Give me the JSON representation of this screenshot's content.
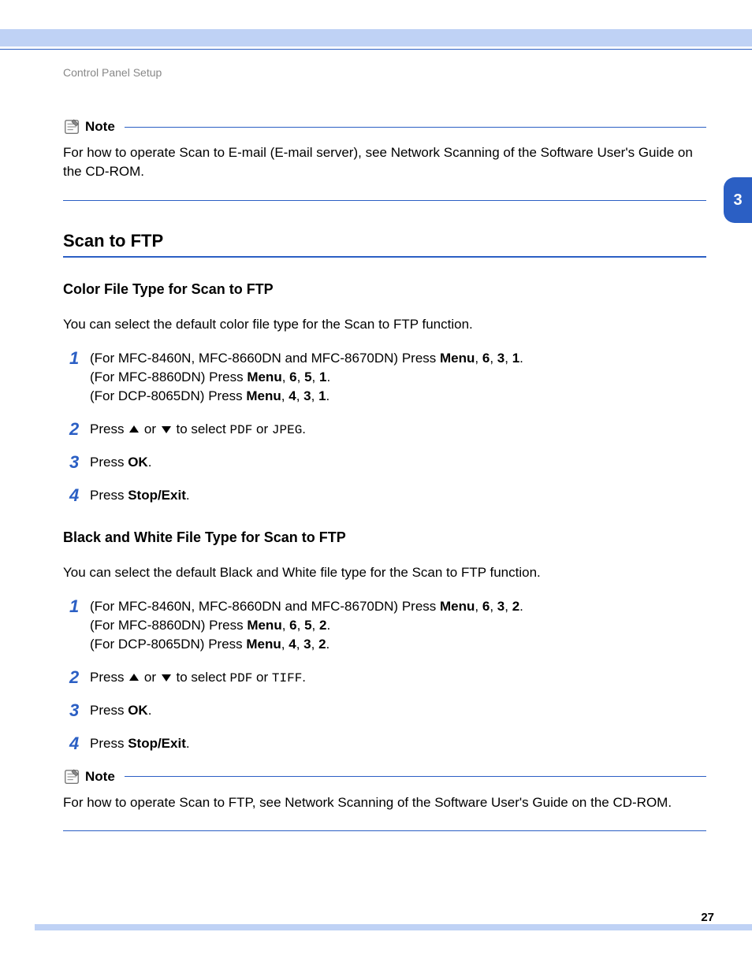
{
  "runningHeader": "Control Panel Setup",
  "chapterNumber": "3",
  "pageNumber": "27",
  "note1": {
    "label": "Note",
    "text": "For how to operate Scan to E-mail (E-mail server), see Network Scanning of the Software User's Guide on the CD-ROM."
  },
  "section": {
    "title": "Scan to FTP",
    "sub1": {
      "title": "Color File Type for Scan to FTP",
      "intro": "You can select the default color file type for the Scan to FTP function.",
      "step1": {
        "line1_a": "(For MFC-8460N, MFC-8660DN and MFC-8670DN) Press ",
        "line1_menu": "Menu",
        "line1_b": ", ",
        "line1_k1": "6",
        "line1_c": ", ",
        "line1_k2": "3",
        "line1_d": ", ",
        "line1_k3": "1",
        "line1_e": ".",
        "line2_a": "(For MFC-8860DN) Press ",
        "line2_menu": "Menu",
        "line2_b": ", ",
        "line2_k1": "6",
        "line2_c": ", ",
        "line2_k2": "5",
        "line2_d": ", ",
        "line2_k3": "1",
        "line2_e": ".",
        "line3_a": "(For DCP-8065DN) Press ",
        "line3_menu": "Menu",
        "line3_b": ", ",
        "line3_k1": "4",
        "line3_c": ", ",
        "line3_k2": "3",
        "line3_d": ", ",
        "line3_k3": "1",
        "line3_e": "."
      },
      "step2": {
        "a": "Press ",
        "b": " or ",
        "c": " to select ",
        "opt1": "PDF",
        "d": " or ",
        "opt2": "JPEG",
        "e": "."
      },
      "step3": {
        "a": "Press ",
        "ok": "OK",
        "b": "."
      },
      "step4": {
        "a": "Press ",
        "stop": "Stop/Exit",
        "b": "."
      }
    },
    "sub2": {
      "title": "Black and White File Type for Scan to FTP",
      "intro": "You can select the default Black and White file type for the Scan to FTP function.",
      "step1": {
        "line1_a": "(For MFC-8460N, MFC-8660DN and MFC-8670DN) Press ",
        "line1_menu": "Menu",
        "line1_b": ", ",
        "line1_k1": "6",
        "line1_c": ", ",
        "line1_k2": "3",
        "line1_d": ", ",
        "line1_k3": "2",
        "line1_e": ".",
        "line2_a": "(For MFC-8860DN) Press ",
        "line2_menu": "Menu",
        "line2_b": ", ",
        "line2_k1": "6",
        "line2_c": ", ",
        "line2_k2": "5",
        "line2_d": ", ",
        "line2_k3": "2",
        "line2_e": ".",
        "line3_a": "(For DCP-8065DN) Press ",
        "line3_menu": "Menu",
        "line3_b": ", ",
        "line3_k1": "4",
        "line3_c": ", ",
        "line3_k2": "3",
        "line3_d": ", ",
        "line3_k3": "2",
        "line3_e": "."
      },
      "step2": {
        "a": "Press ",
        "b": " or ",
        "c": " to select ",
        "opt1": "PDF",
        "d": " or ",
        "opt2": "TIFF",
        "e": "."
      },
      "step3": {
        "a": "Press ",
        "ok": "OK",
        "b": "."
      },
      "step4": {
        "a": "Press ",
        "stop": "Stop/Exit",
        "b": "."
      }
    }
  },
  "note2": {
    "label": "Note",
    "text": "For how to operate Scan to FTP, see Network Scanning of the Software User's Guide on the CD-ROM."
  }
}
